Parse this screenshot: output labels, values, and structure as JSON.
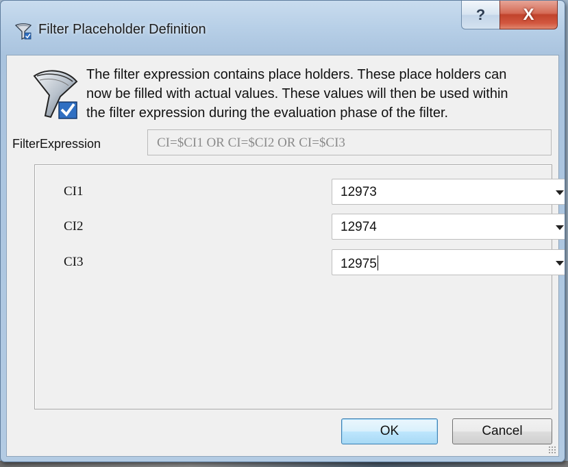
{
  "window": {
    "title": "Filter Placeholder Definition",
    "help_symbol": "?",
    "close_symbol": "X"
  },
  "info": {
    "line1": "The filter expression contains place holders. These place holders can",
    "line2": "now be filled with actual values. These values will then be used within",
    "line3": "the filter expression during the evaluation phase of the filter."
  },
  "filter_expression": {
    "label": "FilterExpression",
    "value": "CI=$CI1 OR CI=$CI2 OR CI=$CI3"
  },
  "placeholders": [
    {
      "label": "CI1",
      "value": "12973"
    },
    {
      "label": "CI2",
      "value": "12974"
    },
    {
      "label": "CI3",
      "value": "12975"
    }
  ],
  "buttons": {
    "ok": "OK",
    "cancel": "Cancel"
  },
  "colors": {
    "title_accent": "#b7cfe7",
    "close_button": "#c9432e",
    "ok_button": "#bee6fd"
  }
}
